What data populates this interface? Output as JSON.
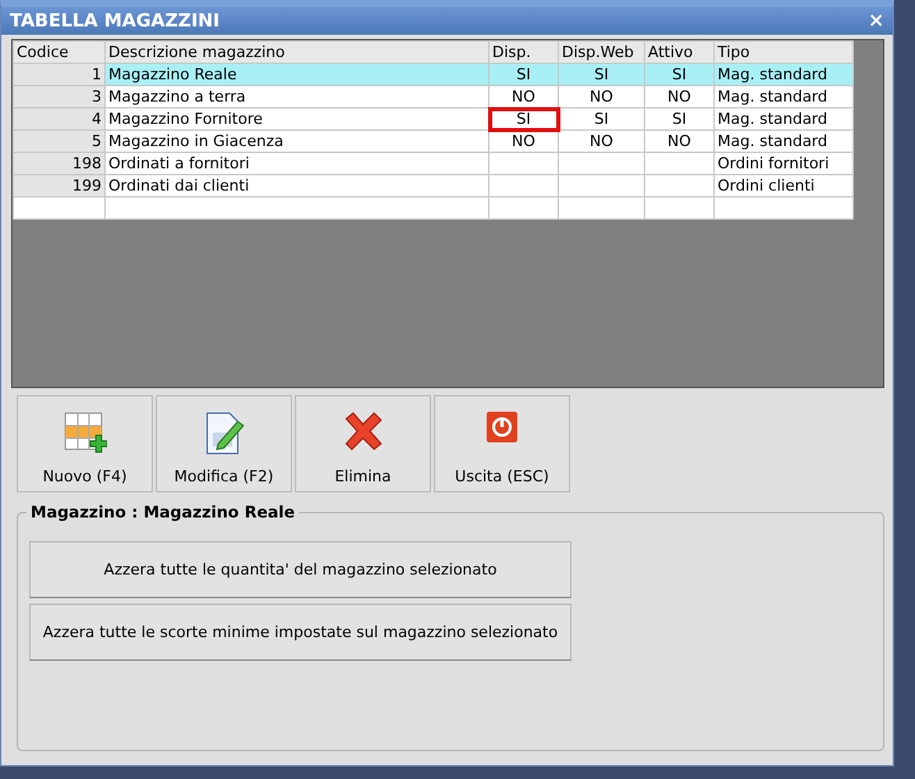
{
  "window": {
    "title": "TABELLA MAGAZZINI",
    "close": "×"
  },
  "table": {
    "columns": [
      "Codice",
      "Descrizione magazzino",
      "Disp.",
      "Disp.Web",
      "Attivo",
      "Tipo"
    ],
    "rows": [
      {
        "codice": "1",
        "descrizione": "Magazzino Reale",
        "disp": "SI",
        "disp_web": "SI",
        "attivo": "SI",
        "tipo": "Mag. standard",
        "selected": true,
        "disp_highlighted": false
      },
      {
        "codice": "3",
        "descrizione": "Magazzino a terra",
        "disp": "NO",
        "disp_web": "NO",
        "attivo": "NO",
        "tipo": "Mag. standard",
        "selected": false,
        "disp_highlighted": false
      },
      {
        "codice": "4",
        "descrizione": "Magazzino Fornitore",
        "disp": "SI",
        "disp_web": "SI",
        "attivo": "SI",
        "tipo": "Mag. standard",
        "selected": false,
        "disp_highlighted": true
      },
      {
        "codice": "5",
        "descrizione": "Magazzino in Giacenza",
        "disp": "NO",
        "disp_web": "NO",
        "attivo": "NO",
        "tipo": "Mag. standard",
        "selected": false,
        "disp_highlighted": false
      },
      {
        "codice": "198",
        "descrizione": "Ordinati a fornitori",
        "disp": "",
        "disp_web": "",
        "attivo": "",
        "tipo": "Ordini fornitori",
        "selected": false,
        "disp_highlighted": false
      },
      {
        "codice": "199",
        "descrizione": "Ordinati dai clienti",
        "disp": "",
        "disp_web": "",
        "attivo": "",
        "tipo": "Ordini clienti",
        "selected": false,
        "disp_highlighted": false
      }
    ]
  },
  "toolbar": [
    {
      "kind": "new",
      "label": "Nuovo (F4)"
    },
    {
      "kind": "edit",
      "label": "Modifica (F2)"
    },
    {
      "kind": "delete",
      "label": "Elimina"
    },
    {
      "kind": "exit",
      "label": "Uscita (ESC)"
    }
  ],
  "group": {
    "title": "Magazzino : Magazzino Reale",
    "buttons": [
      "Azzera tutte le quantita' del magazzino selezionato",
      "Azzera tutte le scorte minime impostate sul magazzino selezionato"
    ]
  }
}
